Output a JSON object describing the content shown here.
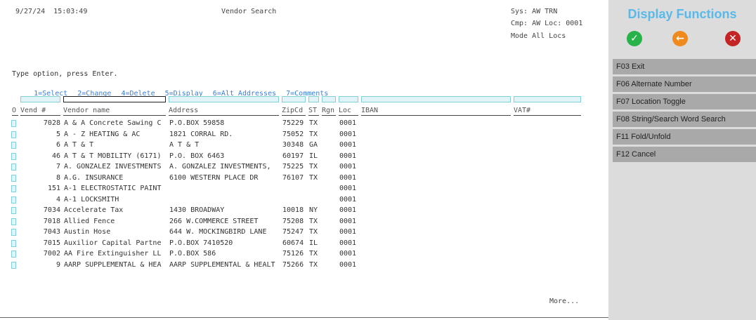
{
  "header": {
    "datetime": "9/27/24  15:03:49",
    "title": "Vendor Search",
    "sys": "Sys: AW TRN",
    "cmp": "Cmp: AW Loc: 0001",
    "mode": "Mode All Locs"
  },
  "instructions": "Type option, press Enter.",
  "options": [
    "1=Select",
    "2=Change",
    "4=Delete",
    "5=Display",
    "6=Alt Addresses",
    "7=Comments"
  ],
  "columns": {
    "opt": "O",
    "vend": "Vend #",
    "name": "Vendor name",
    "address": "Address",
    "zip": "ZipCd",
    "st": "ST",
    "rgn": "Rgn",
    "loc": "Loc",
    "iban": "IBAN",
    "vat": "VAT#"
  },
  "rows": [
    {
      "vend": "7028",
      "name": "A & A Concrete Sawing C",
      "address": "P.O.BOX 59858",
      "zip": "75229",
      "st": "TX",
      "loc": "0001"
    },
    {
      "vend": "5",
      "name": "A - Z HEATING & AC",
      "address": "1821 CORRAL RD.",
      "zip": "75052",
      "st": "TX",
      "loc": "0001"
    },
    {
      "vend": "6",
      "name": "A T & T",
      "address": "A T & T",
      "zip": "30348",
      "st": "GA",
      "loc": "0001"
    },
    {
      "vend": "46",
      "name": "A T & T MOBILITY (6171)",
      "address": "P.O. BOX 6463",
      "zip": "60197",
      "st": "IL",
      "loc": "0001"
    },
    {
      "vend": "7",
      "name": "A. GONZALEZ INVESTMENTS",
      "address": "A. GONZALEZ INVESTMENTS,",
      "zip": "75225",
      "st": "TX",
      "loc": "0001"
    },
    {
      "vend": "8",
      "name": "A.G. INSURANCE",
      "address": "6100 WESTERN PLACE DR",
      "zip": "76107",
      "st": "TX",
      "loc": "0001"
    },
    {
      "vend": "151",
      "name": "A-1 ELECTROSTATIC PAINT",
      "address": "",
      "zip": "",
      "st": "",
      "loc": "0001"
    },
    {
      "vend": "4",
      "name": "A-1 LOCKSMITH",
      "address": "",
      "zip": "",
      "st": "",
      "loc": "0001"
    },
    {
      "vend": "7034",
      "name": "Accelerate Tax",
      "address": "1430 BROADWAY",
      "zip": "10018",
      "st": "NY",
      "loc": "0001"
    },
    {
      "vend": "7018",
      "name": "Allied Fence",
      "address": "266 W.COMMERCE STREET",
      "zip": "75208",
      "st": "TX",
      "loc": "0001"
    },
    {
      "vend": "7043",
      "name": "Austin Hose",
      "address": "644 W. MOCKINGBIRD LANE",
      "zip": "75247",
      "st": "TX",
      "loc": "0001"
    },
    {
      "vend": "7015",
      "name": "Auxilior Capital Partne",
      "address": "P.O.BOX 7410520",
      "zip": "60674",
      "st": "IL",
      "loc": "0001"
    },
    {
      "vend": "7002",
      "name": "AA Fire Extinguisher LL",
      "address": "P.O.BOX 586",
      "zip": "75126",
      "st": "TX",
      "loc": "0001"
    },
    {
      "vend": "9",
      "name": "AARP SUPPLEMENTAL & HEA",
      "address": "AARP SUPPLEMENTAL & HEALT",
      "zip": "75266",
      "st": "TX",
      "loc": "0001"
    }
  ],
  "more": "More...",
  "panel": {
    "title": "Display Functions",
    "icons": [
      "check-icon",
      "back-arrow-icon",
      "close-icon"
    ],
    "fkeys": [
      "F03 Exit",
      "F06 Alternate Number",
      "F07 Location Toggle",
      "F08 String/Search Word Search",
      "F11 Fold/Unfold",
      "F12 Cancel"
    ]
  },
  "colors": {
    "accent": "#59b9ea",
    "option_link": "#3a7fd5",
    "ok": "#27b24a",
    "back": "#ef8a1f",
    "cancel": "#c52424",
    "fkey_bg": "#a9a9a9",
    "panel_bg": "#dcdcdc"
  }
}
